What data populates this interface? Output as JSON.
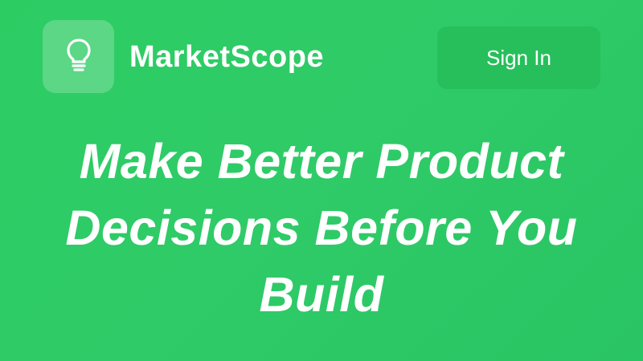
{
  "header": {
    "logo_icon": "lightbulb-icon",
    "brand_name": "MarketScope",
    "signin_label": "Sign In"
  },
  "hero": {
    "title": "Make Better Product Decisions Before You Build"
  },
  "colors": {
    "background": "#2dcc63",
    "button_background": "#27bf5b",
    "text": "#ffffff"
  }
}
